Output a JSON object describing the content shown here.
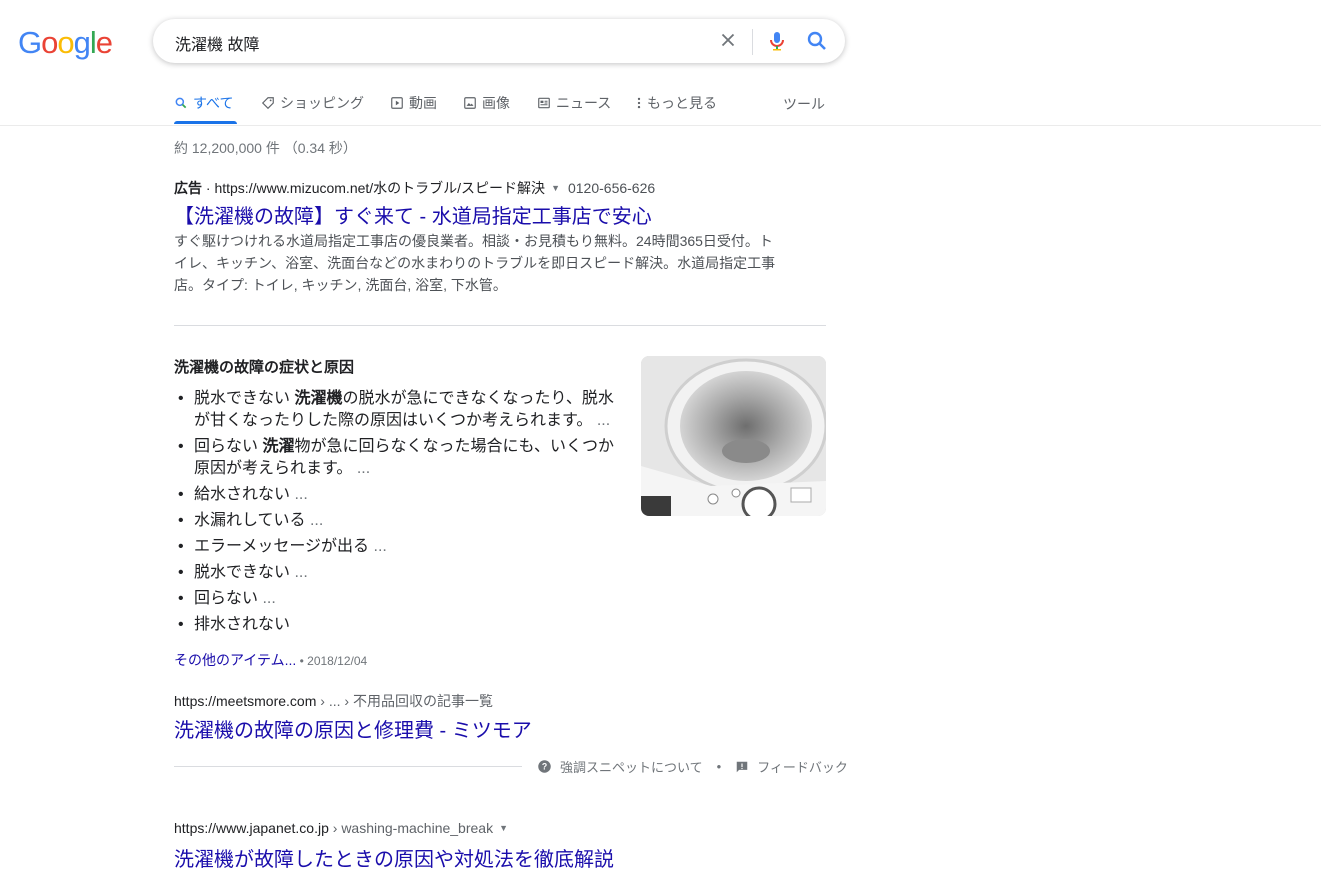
{
  "logo": {
    "letters": [
      "G",
      "o",
      "o",
      "g",
      "l",
      "e"
    ],
    "colors": [
      "#4285f4",
      "#ea4335",
      "#fbbc05",
      "#4285f4",
      "#34a853",
      "#ea4335"
    ]
  },
  "search": {
    "query": "洗濯機 故障"
  },
  "tabs": [
    {
      "label": "すべて",
      "icon": "search-icon",
      "active": true
    },
    {
      "label": "ショッピング",
      "icon": "tag-icon"
    },
    {
      "label": "動画",
      "icon": "play-icon"
    },
    {
      "label": "画像",
      "icon": "image-icon"
    },
    {
      "label": "ニュース",
      "icon": "news-icon"
    },
    {
      "label": "もっと見る",
      "icon": "more-vert-icon"
    }
  ],
  "tools_label": "ツール",
  "stats": "約 12,200,000 件 （0.34 秒）",
  "ad": {
    "badge": "広告",
    "sep": " · ",
    "url": "https://www.mizucom.net/水のトラブル/スピード解決",
    "phone": "0120-656-626",
    "title": "【洗濯機の故障】すぐ来て - 水道局指定工事店で安心",
    "description": "すぐ駆けつけれる水道局指定工事店の優良業者。相談・お見積もり無料。24時間365日受付。トイレ、キッチン、浴室、洗面台などの水まわりのトラブルを即日スピード解決。水道局指定工事店。タイプ: トイレ, キッチン, 洗面台, 浴室, 下水管。"
  },
  "snippet": {
    "heading": "洗濯機の故障の症状と原因",
    "items": [
      {
        "pre": "脱水できない ",
        "bold": "洗濯機",
        "post": "の脱水が急にできなくなったり、脱水が甘くなったりした際の原因はいくつか考えられます。",
        "ellipsis": " ..."
      },
      {
        "pre": "回らない ",
        "bold": "洗濯",
        "post": "物が急に回らなくなった場合にも、いくつか原因が考えられます。",
        "ellipsis": " ..."
      },
      {
        "pre": "給水されない",
        "bold": "",
        "post": "",
        "ellipsis": " ..."
      },
      {
        "pre": "水漏れしている",
        "bold": "",
        "post": "",
        "ellipsis": " ..."
      },
      {
        "pre": "エラーメッセージが出る",
        "bold": "",
        "post": "",
        "ellipsis": " ..."
      },
      {
        "pre": "脱水できない",
        "bold": "",
        "post": "",
        "ellipsis": " ..."
      },
      {
        "pre": "回らない",
        "bold": "",
        "post": "",
        "ellipsis": " ..."
      },
      {
        "pre": "排水されない",
        "bold": "",
        "post": "",
        "ellipsis": ""
      }
    ],
    "more_link": "その他のアイテム...",
    "date_sep": " • ",
    "date": "2018/12/04",
    "source_url": "https://meetsmore.com",
    "source_crumb": " › ... › 不用品回収の記事一覧",
    "source_title": "洗濯機の故障の原因と修理費 - ミツモア",
    "about": "強調スニペットについて",
    "dot": "•",
    "feedback": "フィードバック"
  },
  "result3": {
    "url": "https://www.japanet.co.jp",
    "crumb": " › washing-machine_break",
    "title": "洗濯機が故障したときの原因や対処法を徹底解説"
  }
}
